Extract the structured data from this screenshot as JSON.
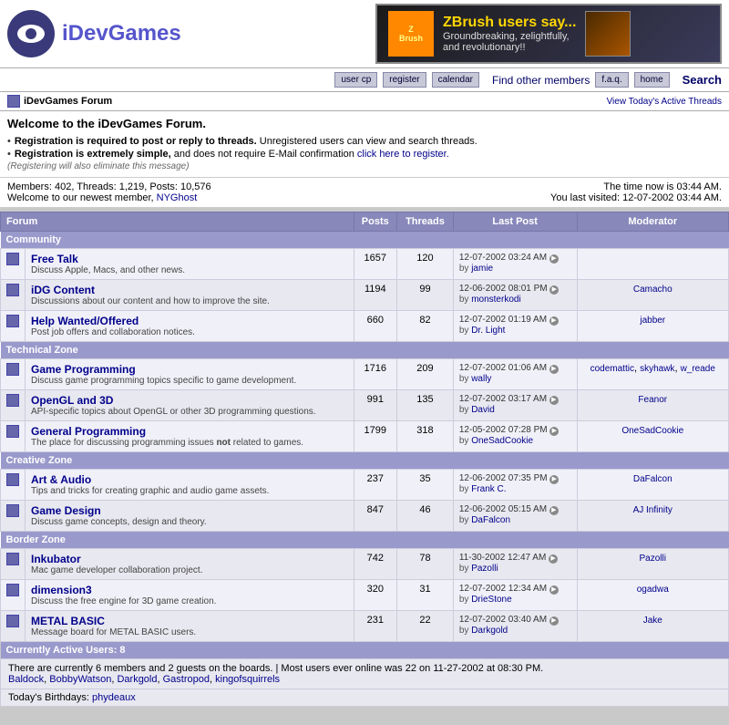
{
  "site": {
    "title": "iDevGames",
    "logo_text": "iDevGames"
  },
  "banner": {
    "brand": "ZBrush",
    "tagline": "ZBrush users say...",
    "text1": "Groundbreaking, zelightfully,",
    "text2": "and revolutionary!!"
  },
  "nav": {
    "buttons": [
      "user cp",
      "register",
      "calendar"
    ],
    "right_buttons": [
      "f.a.q.",
      "home"
    ],
    "find_members_label": "Find other members",
    "search_label": "Search"
  },
  "page_title": "iDevGames Forum",
  "welcome_heading": "Welcome to the iDevGames Forum.",
  "notices": [
    {
      "bold": "Registration is required to post or reply to threads.",
      "text": " Unregistered users can view and search threads."
    },
    {
      "bold": "Registration is extremely simple,",
      "text": " and does not require E-Mail confirmation ",
      "link": "click here to register.",
      "link_href": "#"
    }
  ],
  "note": "(Registering will also eliminate this message)",
  "stats": {
    "members": "402",
    "threads": "1,219",
    "posts": "10,576",
    "newest_member": "NYGhost",
    "time_now": "The time now is 03:44 AM.",
    "last_visited": "You last visited: 12-07-2002 03:44 AM."
  },
  "active_threads_label": "View Today's Active Threads",
  "table_headers": [
    "Forum",
    "Posts",
    "Threads",
    "Last Post",
    "Moderator"
  ],
  "sections": [
    {
      "name": "Community",
      "forums": [
        {
          "name": "Free Talk",
          "desc": "Discuss Apple, Macs, and other news.",
          "posts": "1657",
          "threads": "120",
          "last_post_date": "12-07-2002 03:24 AM",
          "last_post_by": "jamie",
          "moderator": ""
        },
        {
          "name": "iDG Content",
          "desc": "Discussions about our content and how to improve the site.",
          "posts": "1194",
          "threads": "99",
          "last_post_date": "12-06-2002 08:01 PM",
          "last_post_by": "monsterkodi",
          "moderator": "Camacho"
        },
        {
          "name": "Help Wanted/Offered",
          "desc": "Post job offers and collaboration notices.",
          "posts": "660",
          "threads": "82",
          "last_post_date": "12-07-2002 01:19 AM",
          "last_post_by": "Dr. Light",
          "moderator": "jabber"
        }
      ]
    },
    {
      "name": "Technical Zone",
      "forums": [
        {
          "name": "Game Programming",
          "desc": "Discuss game programming topics specific to game development.",
          "posts": "1716",
          "threads": "209",
          "last_post_date": "12-07-2002 01:06 AM",
          "last_post_by": "wally",
          "moderator": "codemattic, skyhawk, w_reade"
        },
        {
          "name": "OpenGL and 3D",
          "desc": "API-specific topics about OpenGL or other 3D programming questions.",
          "posts": "991",
          "threads": "135",
          "last_post_date": "12-07-2002 03:17 AM",
          "last_post_by": "David",
          "moderator": "Feanor"
        },
        {
          "name": "General Programming",
          "desc": "The place for discussing programming issues not related to games.",
          "posts": "1799",
          "threads": "318",
          "last_post_date": "12-05-2002 07:28 PM",
          "last_post_by": "OneSadCookie",
          "moderator": "OneSadCookie"
        }
      ]
    },
    {
      "name": "Creative Zone",
      "forums": [
        {
          "name": "Art & Audio",
          "desc": "Tips and tricks for creating graphic and audio game assets.",
          "posts": "237",
          "threads": "35",
          "last_post_date": "12-06-2002 07:35 PM",
          "last_post_by": "Frank C.",
          "moderator": "DaFalcon"
        },
        {
          "name": "Game Design",
          "desc": "Discuss game concepts, design and theory.",
          "posts": "847",
          "threads": "46",
          "last_post_date": "12-06-2002 05:15 AM",
          "last_post_by": "DaFalcon",
          "moderator": "AJ Infinity"
        }
      ]
    },
    {
      "name": "Border Zone",
      "forums": [
        {
          "name": "Inkubator",
          "desc": "Mac game developer collaboration project.",
          "posts": "742",
          "threads": "78",
          "last_post_date": "11-30-2002 12:47 AM",
          "last_post_by": "Pazolli",
          "moderator": "Pazolli"
        },
        {
          "name": "dimension3",
          "desc": "Discuss the free engine for 3D game creation.",
          "posts": "320",
          "threads": "31",
          "last_post_date": "12-07-2002 12:34 AM",
          "last_post_by": "DrieStone",
          "moderator": "ogadwa"
        },
        {
          "name": "METAL BASIC",
          "desc": "Message board for METAL BASIC users.",
          "posts": "231",
          "threads": "22",
          "last_post_date": "12-07-2002 03:40 AM",
          "last_post_by": "Darkgold",
          "moderator": "Jake"
        }
      ]
    }
  ],
  "active_users": {
    "header": "Currently Active Users: 8",
    "description": "There are currently 6 members and 2 guests on the boards. | Most users ever online was 22 on 11-27-2002 at 08:30 PM.",
    "users": [
      "Baldock",
      "BobbyWatson",
      "Darkgold",
      "Gastropod",
      "kingofsquirrels"
    ],
    "birthdays_label": "Today's Birthdays:",
    "birthdays": [
      "phydeaux"
    ]
  }
}
